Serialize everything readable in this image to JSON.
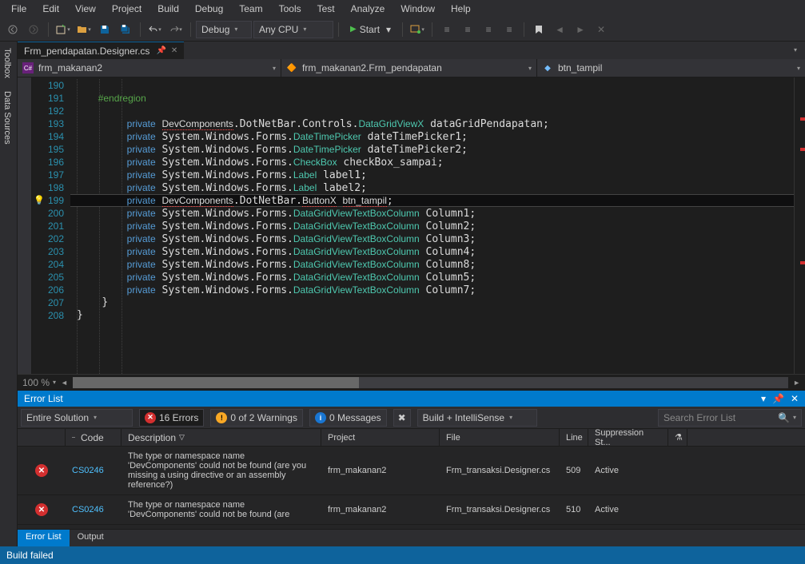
{
  "menu": {
    "file": "File",
    "edit": "Edit",
    "view": "View",
    "project": "Project",
    "build": "Build",
    "debug": "Debug",
    "team": "Team",
    "tools": "Tools",
    "test": "Test",
    "analyze": "Analyze",
    "window": "Window",
    "help": "Help"
  },
  "toolbar": {
    "config": "Debug",
    "platform": "Any CPU",
    "start": "Start"
  },
  "side": {
    "toolbox": "Toolbox",
    "datasources": "Data Sources"
  },
  "tab": {
    "name": "Frm_pendapatan.Designer.cs"
  },
  "nav": {
    "class": "frm_makanan2",
    "type": "frm_makanan2.Frm_pendapatan",
    "member": "btn_tampil"
  },
  "zoom": {
    "pct": "100 %"
  },
  "code": {
    "lines": [
      {
        "n": "190",
        "t": ""
      },
      {
        "n": "191",
        "t": "        #endregion",
        "cmt": true
      },
      {
        "n": "192",
        "t": ""
      },
      {
        "n": "193",
        "t": "        private <r>DevComponents</r>.DotNetBar.Controls.<c>DataGridViewX</c> dataGridPendapatan;"
      },
      {
        "n": "194",
        "t": "        private System.Windows.Forms.<c>DateTimePicker</c> dateTimePicker1;"
      },
      {
        "n": "195",
        "t": "        private System.Windows.Forms.<c>DateTimePicker</c> dateTimePicker2;"
      },
      {
        "n": "196",
        "t": "        private System.Windows.Forms.<c>CheckBox</c> checkBox_sampai;"
      },
      {
        "n": "197",
        "t": "        private System.Windows.Forms.<c>Label</c> label1;"
      },
      {
        "n": "198",
        "t": "        private System.Windows.Forms.<c>Label</c> label2;"
      },
      {
        "n": "199",
        "t": "        private <r>DevComponents</r>.DotNetBar.<r>ButtonX</r> <r>btn_tampil</r>;",
        "hl": true,
        "bulb": true
      },
      {
        "n": "200",
        "t": "        private System.Windows.Forms.<c>DataGridViewTextBoxColumn</c> Column1;"
      },
      {
        "n": "201",
        "t": "        private System.Windows.Forms.<c>DataGridViewTextBoxColumn</c> Column2;"
      },
      {
        "n": "202",
        "t": "        private System.Windows.Forms.<c>DataGridViewTextBoxColumn</c> Column3;"
      },
      {
        "n": "203",
        "t": "        private System.Windows.Forms.<c>DataGridViewTextBoxColumn</c> Column4;"
      },
      {
        "n": "204",
        "t": "        private System.Windows.Forms.<c>DataGridViewTextBoxColumn</c> Column8;"
      },
      {
        "n": "205",
        "t": "        private System.Windows.Forms.<c>DataGridViewTextBoxColumn</c> Column5;"
      },
      {
        "n": "206",
        "t": "        private System.Windows.Forms.<c>DataGridViewTextBoxColumn</c> Column7;"
      },
      {
        "n": "207",
        "t": "    }"
      },
      {
        "n": "208",
        "t": "}"
      }
    ]
  },
  "errorlist": {
    "title": "Error List",
    "scope": "Entire Solution",
    "errors": "16 Errors",
    "warnings": "0 of 2 Warnings",
    "messages": "0 Messages",
    "filter": "Build + IntelliSense",
    "search": "Search Error List",
    "cols": {
      "code": "Code",
      "desc": "Description",
      "project": "Project",
      "file": "File",
      "line": "Line",
      "supp": "Suppression St..."
    },
    "rows": [
      {
        "code": "CS0246",
        "desc": "The type or namespace name 'DevComponents' could not be found (are you missing a using directive or an assembly reference?)",
        "project": "frm_makanan2",
        "file": "Frm_transaksi.Designer.cs",
        "line": "509",
        "state": "Active"
      },
      {
        "code": "CS0246",
        "desc": "The type or namespace name 'DevComponents' could not be found (are",
        "project": "frm_makanan2",
        "file": "Frm_transaksi.Designer.cs",
        "line": "510",
        "state": "Active"
      }
    ],
    "tabs": {
      "errorlist": "Error List",
      "output": "Output"
    }
  },
  "status": {
    "text": "Build failed"
  }
}
